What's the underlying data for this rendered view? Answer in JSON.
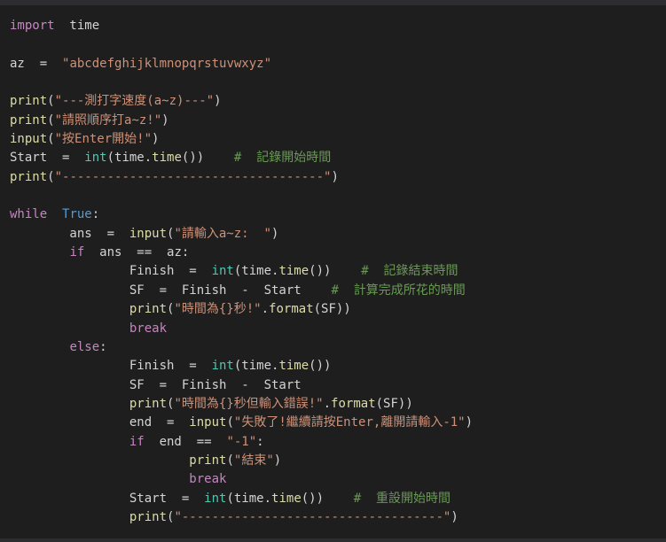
{
  "editor": {
    "colors": {
      "background": "#1e1e1e",
      "keyword": "#c586c0",
      "function": "#dcdcaa",
      "string": "#ce9178",
      "comment": "#6a9955",
      "builtin": "#4ec9b0",
      "constant": "#569cd6",
      "text": "#d4d4d4"
    },
    "lines": [
      [
        {
          "c": "k",
          "v": "import"
        },
        {
          "c": "p",
          "v": "  time"
        }
      ],
      [],
      [
        {
          "c": "p",
          "v": "az  =  "
        },
        {
          "c": "s",
          "v": "\"abcdefghijklmnopqrstuvwxyz\""
        }
      ],
      [],
      [
        {
          "c": "f",
          "v": "print"
        },
        {
          "c": "p",
          "v": "("
        },
        {
          "c": "s",
          "v": "\"---測打字速度(a~z)---\""
        },
        {
          "c": "p",
          "v": ")"
        }
      ],
      [
        {
          "c": "f",
          "v": "print"
        },
        {
          "c": "p",
          "v": "("
        },
        {
          "c": "s",
          "v": "\"請照順序打a~z!\""
        },
        {
          "c": "p",
          "v": ")"
        }
      ],
      [
        {
          "c": "f",
          "v": "input"
        },
        {
          "c": "p",
          "v": "("
        },
        {
          "c": "s",
          "v": "\"按Enter開始!\""
        },
        {
          "c": "p",
          "v": ")"
        }
      ],
      [
        {
          "c": "p",
          "v": "Start  =  "
        },
        {
          "c": "b",
          "v": "int"
        },
        {
          "c": "p",
          "v": "(time."
        },
        {
          "c": "f",
          "v": "time"
        },
        {
          "c": "p",
          "v": "())    "
        },
        {
          "c": "c",
          "v": "#  記錄開始時間"
        }
      ],
      [
        {
          "c": "f",
          "v": "print"
        },
        {
          "c": "p",
          "v": "("
        },
        {
          "c": "s",
          "v": "\"-----------------------------------\""
        },
        {
          "c": "p",
          "v": ")"
        }
      ],
      [],
      [
        {
          "c": "k",
          "v": "while"
        },
        {
          "c": "p",
          "v": "  "
        },
        {
          "c": "t",
          "v": "True"
        },
        {
          "c": "p",
          "v": ":"
        }
      ],
      [
        {
          "c": "p",
          "v": "        ans  =  "
        },
        {
          "c": "f",
          "v": "input"
        },
        {
          "c": "p",
          "v": "("
        },
        {
          "c": "s",
          "v": "\"請輸入a~z:  \""
        },
        {
          "c": "p",
          "v": ")"
        }
      ],
      [
        {
          "c": "p",
          "v": "        "
        },
        {
          "c": "k",
          "v": "if"
        },
        {
          "c": "p",
          "v": "  ans  ==  az:"
        }
      ],
      [
        {
          "c": "p",
          "v": "                Finish  =  "
        },
        {
          "c": "b",
          "v": "int"
        },
        {
          "c": "p",
          "v": "(time."
        },
        {
          "c": "f",
          "v": "time"
        },
        {
          "c": "p",
          "v": "())    "
        },
        {
          "c": "c",
          "v": "#  記錄結束時間"
        }
      ],
      [
        {
          "c": "p",
          "v": "                SF  =  Finish  -  Start    "
        },
        {
          "c": "c",
          "v": "#  計算完成所花的時間"
        }
      ],
      [
        {
          "c": "p",
          "v": "                "
        },
        {
          "c": "f",
          "v": "print"
        },
        {
          "c": "p",
          "v": "("
        },
        {
          "c": "s",
          "v": "\"時間為{}秒!\""
        },
        {
          "c": "p",
          "v": "."
        },
        {
          "c": "f",
          "v": "format"
        },
        {
          "c": "p",
          "v": "(SF))"
        }
      ],
      [
        {
          "c": "p",
          "v": "                "
        },
        {
          "c": "k",
          "v": "break"
        }
      ],
      [
        {
          "c": "p",
          "v": "        "
        },
        {
          "c": "k",
          "v": "else"
        },
        {
          "c": "p",
          "v": ":"
        }
      ],
      [
        {
          "c": "p",
          "v": "                Finish  =  "
        },
        {
          "c": "b",
          "v": "int"
        },
        {
          "c": "p",
          "v": "(time."
        },
        {
          "c": "f",
          "v": "time"
        },
        {
          "c": "p",
          "v": "())"
        }
      ],
      [
        {
          "c": "p",
          "v": "                SF  =  Finish  -  Start"
        }
      ],
      [
        {
          "c": "p",
          "v": "                "
        },
        {
          "c": "f",
          "v": "print"
        },
        {
          "c": "p",
          "v": "("
        },
        {
          "c": "s",
          "v": "\"時間為{}秒但輸入錯誤!\""
        },
        {
          "c": "p",
          "v": "."
        },
        {
          "c": "f",
          "v": "format"
        },
        {
          "c": "p",
          "v": "(SF))"
        }
      ],
      [
        {
          "c": "p",
          "v": "                end  =  "
        },
        {
          "c": "f",
          "v": "input"
        },
        {
          "c": "p",
          "v": "("
        },
        {
          "c": "s",
          "v": "\"失敗了!繼續請按Enter,離開請輸入-1\""
        },
        {
          "c": "p",
          "v": ")"
        }
      ],
      [
        {
          "c": "p",
          "v": "                "
        },
        {
          "c": "k",
          "v": "if"
        },
        {
          "c": "p",
          "v": "  end  ==  "
        },
        {
          "c": "s",
          "v": "\"-1\""
        },
        {
          "c": "p",
          "v": ":"
        }
      ],
      [
        {
          "c": "p",
          "v": "                        "
        },
        {
          "c": "f",
          "v": "print"
        },
        {
          "c": "p",
          "v": "("
        },
        {
          "c": "s",
          "v": "\"結束\""
        },
        {
          "c": "p",
          "v": ")"
        }
      ],
      [
        {
          "c": "p",
          "v": "                        "
        },
        {
          "c": "k",
          "v": "break"
        }
      ],
      [
        {
          "c": "p",
          "v": "                Start  =  "
        },
        {
          "c": "b",
          "v": "int"
        },
        {
          "c": "p",
          "v": "(time."
        },
        {
          "c": "f",
          "v": "time"
        },
        {
          "c": "p",
          "v": "())    "
        },
        {
          "c": "c",
          "v": "#  重設開始時間"
        }
      ],
      [
        {
          "c": "p",
          "v": "                "
        },
        {
          "c": "f",
          "v": "print"
        },
        {
          "c": "p",
          "v": "("
        },
        {
          "c": "s",
          "v": "\"-----------------------------------\""
        },
        {
          "c": "p",
          "v": ")"
        }
      ]
    ]
  }
}
